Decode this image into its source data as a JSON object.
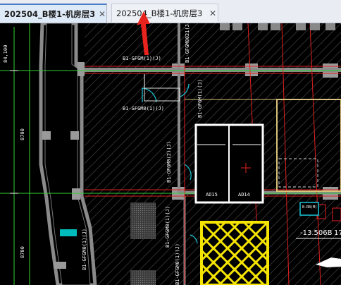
{
  "tabs": [
    {
      "label": "202504_B楼1-机房层3",
      "close": "✕"
    },
    {
      "label": "202504_B楼1-机房层3",
      "close": "✕"
    }
  ],
  "drawing": {
    "dim_left_top": "84,100",
    "dim_left_mid": "8700",
    "dim_left_bot": "8700",
    "door_labels": {
      "door_top": "B1-GFGM(1)(J)",
      "door_upper": "B1-GFGM0021(J)",
      "door_left": "B1-GFGM0(1)(J)",
      "door_right_a": "B1-GFGM(1)(J)",
      "door_mid_a": "B1-GFGM0(2)(J)",
      "door_mid_b": "B1-GFGM0(1)(J)",
      "door_bottom_left": "B1-GFGM0(1)(J)",
      "door_bottom_right": "B1-GFGM0(1)(J)"
    },
    "equip_label_a": "AD15",
    "equip_label_b": "AD14",
    "elevation_a": "-13.506B",
    "elevation_b": "17",
    "small_box_label": "B-RB(M)"
  },
  "colors": {
    "hatch": "#4a4a4a",
    "wall": "#8a8a8a",
    "grid_red": "#e02020",
    "grid_green": "#2fd22f",
    "yellow": "#f5e300",
    "cyan": "#19c8d8",
    "white": "#ffffff"
  }
}
